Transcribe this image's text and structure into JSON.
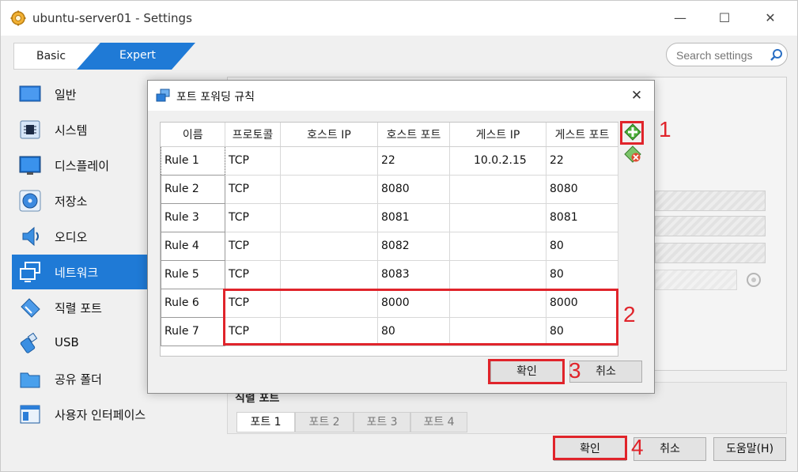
{
  "window": {
    "title": "ubuntu-server01 - Settings",
    "controls": {
      "minimize": "—",
      "maximize": "☐",
      "close": "✕"
    }
  },
  "mode_tabs": {
    "basic": "Basic",
    "expert": "Expert"
  },
  "search": {
    "placeholder": "Search settings"
  },
  "sidebar": {
    "items": [
      {
        "label": "일반",
        "icon": "general-icon"
      },
      {
        "label": "시스템",
        "icon": "system-chip-icon"
      },
      {
        "label": "디스플레이",
        "icon": "display-monitor-icon"
      },
      {
        "label": "저장소",
        "icon": "storage-disc-icon"
      },
      {
        "label": "오디오",
        "icon": "audio-speaker-icon"
      },
      {
        "label": "네트워크",
        "icon": "network-icon",
        "active": true
      },
      {
        "label": "직렬 포트",
        "icon": "serial-port-icon"
      },
      {
        "label": "USB",
        "icon": "usb-icon"
      },
      {
        "label": "공유 폴더",
        "icon": "shared-folder-icon"
      },
      {
        "label": "사용자 인터페이스",
        "icon": "user-interface-icon"
      }
    ]
  },
  "serial_ports": {
    "title": "직렬 포트",
    "tabs": [
      "포트 1",
      "포트 2",
      "포트 3",
      "포트 4"
    ]
  },
  "bottom_buttons": {
    "ok": "확인",
    "cancel": "취소",
    "help": "도움말(H)"
  },
  "dialog": {
    "title": "포트 포워딩 규칙",
    "close": "✕",
    "columns": [
      "이름",
      "프로토콜",
      "호스트 IP",
      "호스트 포트",
      "게스트 IP",
      "게스트 포트"
    ],
    "rules": [
      {
        "name": "Rule 1",
        "protocol": "TCP",
        "host_ip": "",
        "host_port": "22",
        "guest_ip": "10.0.2.15",
        "guest_port": "22"
      },
      {
        "name": "Rule 2",
        "protocol": "TCP",
        "host_ip": "",
        "host_port": "8080",
        "guest_ip": "",
        "guest_port": "8080"
      },
      {
        "name": "Rule 3",
        "protocol": "TCP",
        "host_ip": "",
        "host_port": "8081",
        "guest_ip": "",
        "guest_port": "8081"
      },
      {
        "name": "Rule 4",
        "protocol": "TCP",
        "host_ip": "",
        "host_port": "8082",
        "guest_ip": "",
        "guest_port": "80"
      },
      {
        "name": "Rule 5",
        "protocol": "TCP",
        "host_ip": "",
        "host_port": "8083",
        "guest_ip": "",
        "guest_port": "80"
      },
      {
        "name": "Rule 6",
        "protocol": "TCP",
        "host_ip": "",
        "host_port": "8000",
        "guest_ip": "",
        "guest_port": "8000"
      },
      {
        "name": "Rule 7",
        "protocol": "TCP",
        "host_ip": "",
        "host_port": "80",
        "guest_ip": "",
        "guest_port": "80"
      }
    ],
    "add_rule_icon": "add-rule-icon",
    "remove_rule_icon": "remove-rule-icon",
    "ok": "확인",
    "cancel": "취소"
  },
  "annotations": {
    "n1": "1",
    "n2": "2",
    "n3": "3",
    "n4": "4",
    "color": "#e0242b"
  },
  "colors": {
    "accent": "#1f7ad6",
    "annotation": "#e0242b"
  }
}
